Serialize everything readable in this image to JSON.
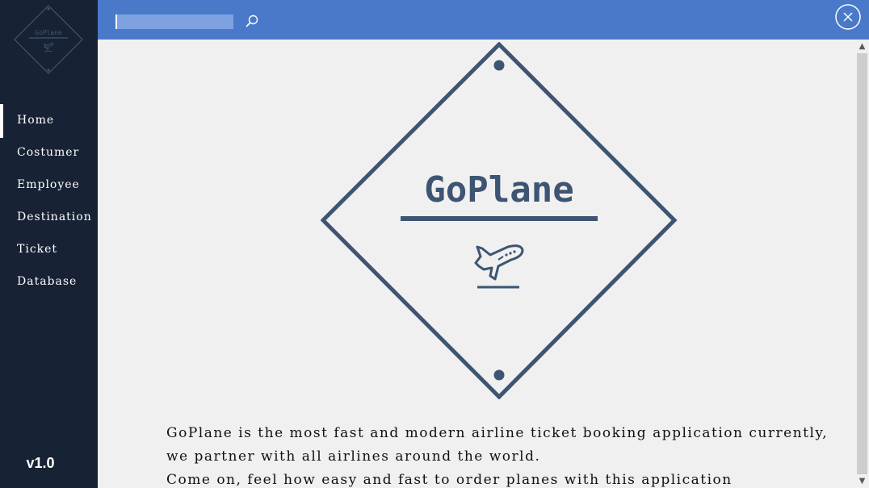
{
  "app": {
    "name": "GoPlane",
    "version": "v1.0"
  },
  "sidebar": {
    "logo_text": "GoPlane",
    "items": [
      {
        "label": "Home",
        "active": true
      },
      {
        "label": "Costumer",
        "active": false
      },
      {
        "label": "Employee",
        "active": false
      },
      {
        "label": "Destination",
        "active": false
      },
      {
        "label": "Ticket",
        "active": false
      },
      {
        "label": "Database",
        "active": false
      }
    ]
  },
  "topbar": {
    "search": {
      "value": "",
      "placeholder": ""
    },
    "search_icon": "search-icon",
    "close_icon": "close-icon"
  },
  "main": {
    "logo_title": "GoPlane",
    "logo_icon": "airplane-icon",
    "description": [
      "GoPlane is the most fast and modern airline ticket booking application currently,",
      "we partner with all airlines around the world.",
      "Come on, feel how easy and fast to order planes with this application"
    ]
  },
  "colors": {
    "sidebar_bg": "#172234",
    "topbar_bg": "#4a79c9",
    "content_bg": "#f0f0f0",
    "logo_color": "#3d5572"
  }
}
